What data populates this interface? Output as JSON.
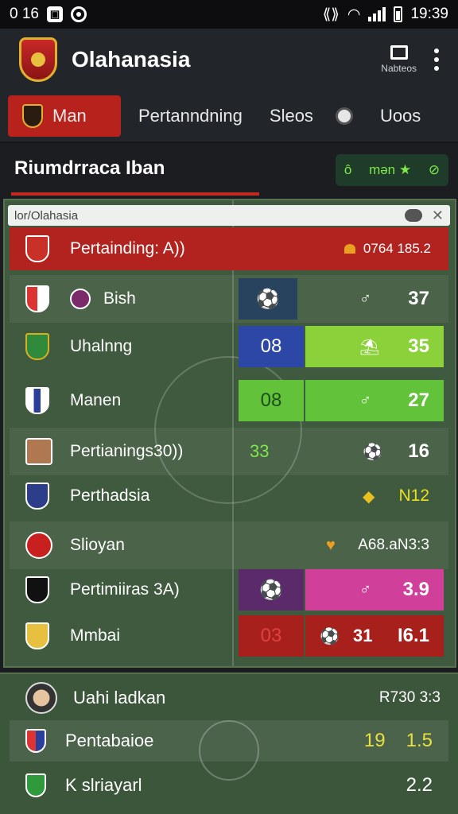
{
  "status_bar": {
    "left_text": "0 16",
    "time": "19:39"
  },
  "app": {
    "title": "Olahanasia",
    "action_label": "Nabteos"
  },
  "tabs": [
    {
      "label": "Man"
    },
    {
      "label": "Pertanndning"
    },
    {
      "label": "Sleos"
    },
    {
      "label": "Uoos"
    }
  ],
  "section": {
    "title": "Riumdrraca Iban",
    "pill_left": "ô",
    "pill_text": "mən ★",
    "pill_right": "⊘"
  },
  "search": {
    "text": "lor/Olahasia"
  },
  "header_row": {
    "label": "Pertainding: A))",
    "right": "0764 185.2"
  },
  "rows": [
    {
      "name": "Bish",
      "value": "37"
    },
    {
      "name": "Uhalnng",
      "tile": "08",
      "value": "35"
    },
    {
      "name": "Manen",
      "tile": "08",
      "value": "27"
    },
    {
      "name": "Pertianings30))",
      "tile": "33",
      "value": "16"
    },
    {
      "name": "Perthadsia",
      "value": "N12"
    },
    {
      "name": "Slioyan",
      "value": "A68.aN3:3"
    },
    {
      "name": "Pertimiiras 3A)",
      "value": "3.9"
    },
    {
      "name": "Mmbai",
      "tile": "03",
      "extra": "31",
      "value": "I6.1"
    }
  ],
  "lower": [
    {
      "name": "Uahi ladkan",
      "value": "R730 3:3"
    },
    {
      "name": "Pentabaioe",
      "value1": "19",
      "value2": "1.5"
    },
    {
      "name": "K slriayarl",
      "value": "2.2"
    }
  ]
}
